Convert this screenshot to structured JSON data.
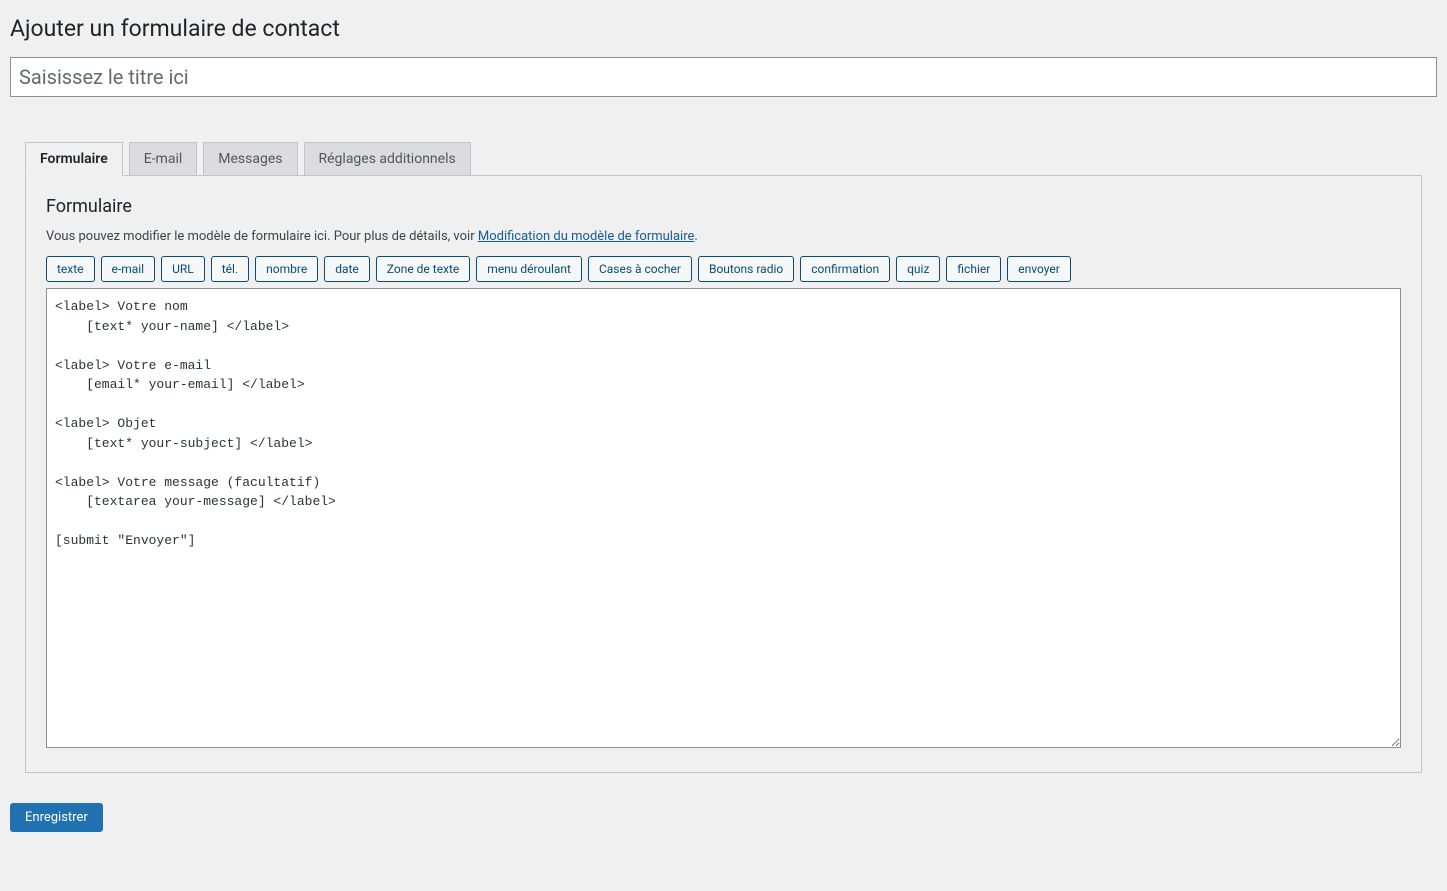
{
  "page_title": "Ajouter un formulaire de contact",
  "title_input": {
    "value": "",
    "placeholder": "Saisissez le titre ici"
  },
  "tabs": [
    {
      "label": "Formulaire",
      "active": true
    },
    {
      "label": "E-mail",
      "active": false
    },
    {
      "label": "Messages",
      "active": false
    },
    {
      "label": "Réglages additionnels",
      "active": false
    }
  ],
  "panel": {
    "heading": "Formulaire",
    "help_prefix": "Vous pouvez modifier le modèle de formulaire ici. Pour plus de détails, voir ",
    "help_link": "Modification du modèle de formulaire",
    "help_suffix": ".",
    "tag_buttons": [
      "texte",
      "e-mail",
      "URL",
      "tél.",
      "nombre",
      "date",
      "Zone de texte",
      "menu déroulant",
      "Cases à cocher",
      "Boutons radio",
      "confirmation",
      "quiz",
      "fichier",
      "envoyer"
    ],
    "template_value": "<label> Votre nom\n    [text* your-name] </label>\n\n<label> Votre e-mail\n    [email* your-email] </label>\n\n<label> Objet\n    [text* your-subject] </label>\n\n<label> Votre message (facultatif)\n    [textarea your-message] </label>\n\n[submit \"Envoyer\"]"
  },
  "save_label": "Enregistrer"
}
